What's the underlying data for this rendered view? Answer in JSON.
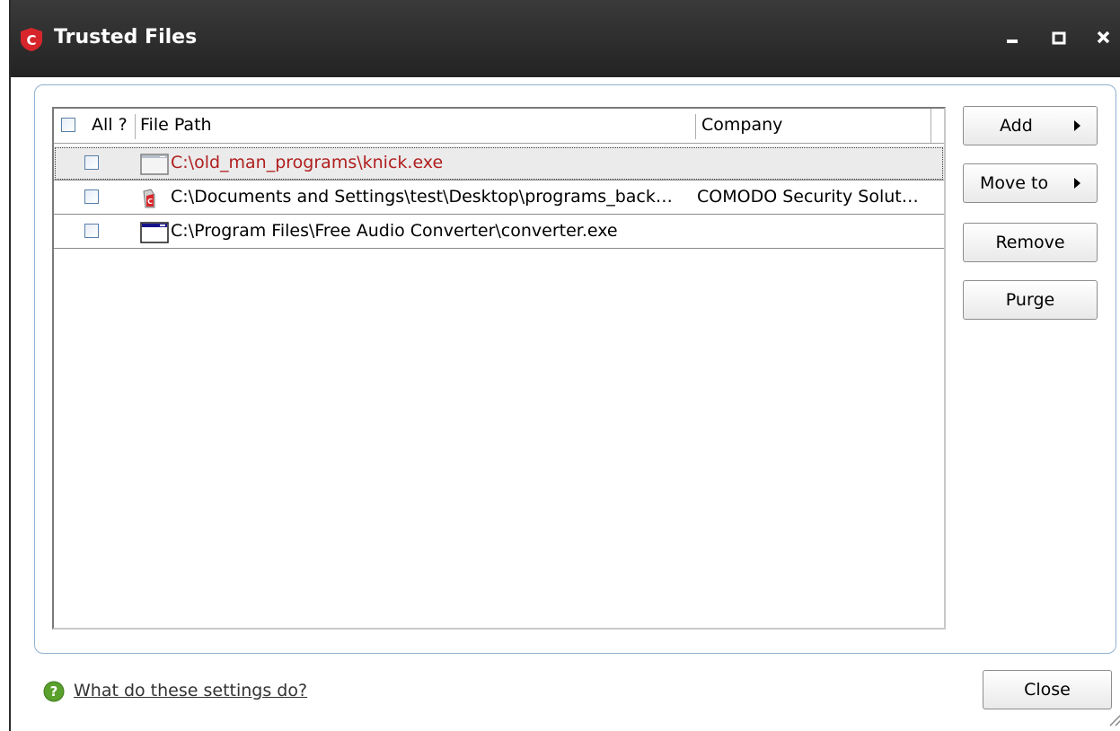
{
  "window": {
    "title": "Trusted Files"
  },
  "header": {
    "all_label": "All ?",
    "file_path_label": "File Path",
    "company_label": "Company"
  },
  "rows": [
    {
      "path": "C:\\old_man_programs\\knick.exe",
      "company": "",
      "icon": "window-app-icon",
      "selected": true,
      "checked": false
    },
    {
      "path": "C:\\Documents and Settings\\test\\Desktop\\programs_back…",
      "company": "COMODO Security Solut…",
      "icon": "comodo-file-icon",
      "selected": false,
      "checked": false
    },
    {
      "path": "C:\\Program Files\\Free Audio Converter\\converter.exe",
      "company": "",
      "icon": "window-app-icon",
      "selected": false,
      "checked": false
    }
  ],
  "buttons": {
    "add": "Add",
    "move_to": "Move to",
    "remove": "Remove",
    "purge": "Purge",
    "close": "Close"
  },
  "help": {
    "link": "What do these settings do?"
  },
  "colors": {
    "titlebar": "#2c2c2c",
    "selected_text": "#b01e1e",
    "group_border": "#8fb1d1"
  }
}
